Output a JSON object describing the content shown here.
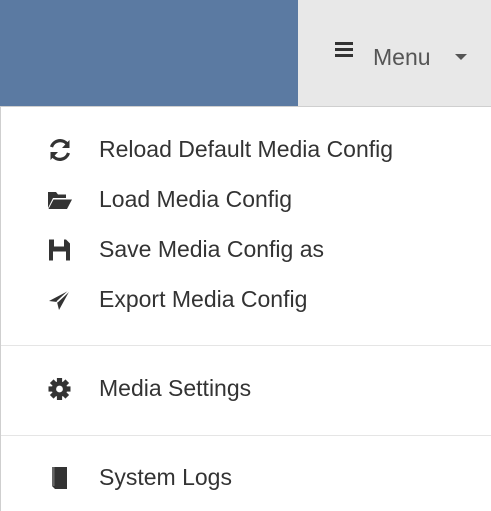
{
  "navbar": {
    "brand_color": "#5b7aa2",
    "toggle_icon": "hamburger-icon",
    "toggle_label": "Menu",
    "toggle_caret": "caret-down-icon"
  },
  "dropdown": {
    "items": [
      {
        "icon": "refresh-icon",
        "label": "Reload Default Media Config"
      },
      {
        "icon": "folder-open-icon",
        "label": "Load Media Config"
      },
      {
        "icon": "floppy-disk-icon",
        "label": "Save Media Config as"
      },
      {
        "icon": "send-icon",
        "label": "Export Media Config"
      },
      {
        "icon": "cog-icon",
        "label": "Media Settings"
      },
      {
        "icon": "book-icon",
        "label": "System Logs"
      }
    ]
  }
}
